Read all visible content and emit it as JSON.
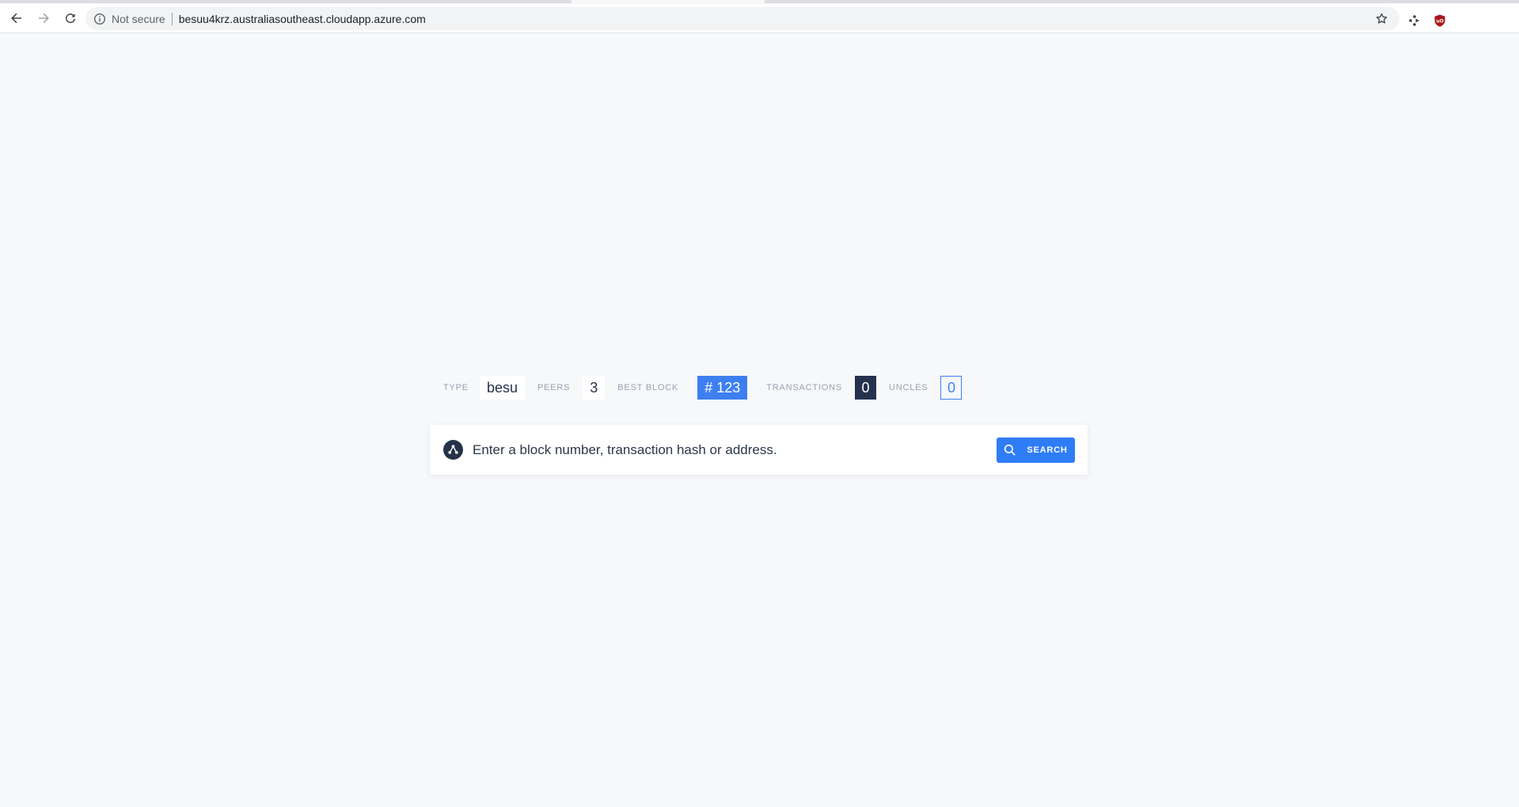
{
  "browser": {
    "security_label": "Not secure",
    "url": "besuu4krz.australiasoutheast.cloudapp.azure.com"
  },
  "stats": {
    "type_label": "TYPE",
    "type_value": "besu",
    "peers_label": "PEERS",
    "peers_value": "3",
    "best_block_label": "BEST BLOCK",
    "best_block_value": "# 123",
    "transactions_label": "TRANSACTIONS",
    "transactions_value": "0",
    "uncles_label": "UNCLES",
    "uncles_value": "0"
  },
  "search": {
    "placeholder": "Enter a block number, transaction hash or address.",
    "button_label": "SEARCH"
  },
  "colors": {
    "accent": "#3d7ff0",
    "dark": "#24324d",
    "background": "#f7f8fa"
  },
  "icons": [
    "back-arrow-icon",
    "forward-arrow-icon",
    "reload-icon",
    "info-icon",
    "star-icon",
    "extension-icon",
    "ublock-icon",
    "network-logo-icon",
    "search-icon"
  ]
}
